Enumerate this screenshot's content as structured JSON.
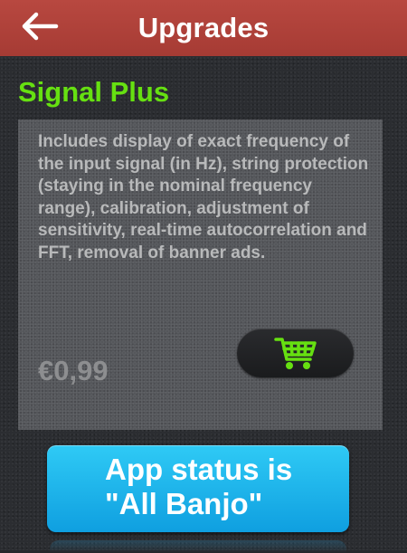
{
  "header": {
    "title": "Upgrades",
    "back_icon": "arrow-left-icon"
  },
  "product": {
    "title": "Signal Plus",
    "description": "Includes display of exact frequency of the input signal (in Hz), string protection (staying in the nominal frequency range), calibration, adjustment of sensitivity, real-time autocorrelation and FFT, removal of banner ads.",
    "price": "€0,99",
    "cart_icon": "shopping-cart-icon"
  },
  "status": {
    "line1": "App status is",
    "line2": "\"All Banjo\""
  },
  "colors": {
    "header": "#a63b34",
    "product_title": "#66e011",
    "cart_icon": "#66e011",
    "status_button": "#1aaeea",
    "background": "#2b2d31"
  }
}
